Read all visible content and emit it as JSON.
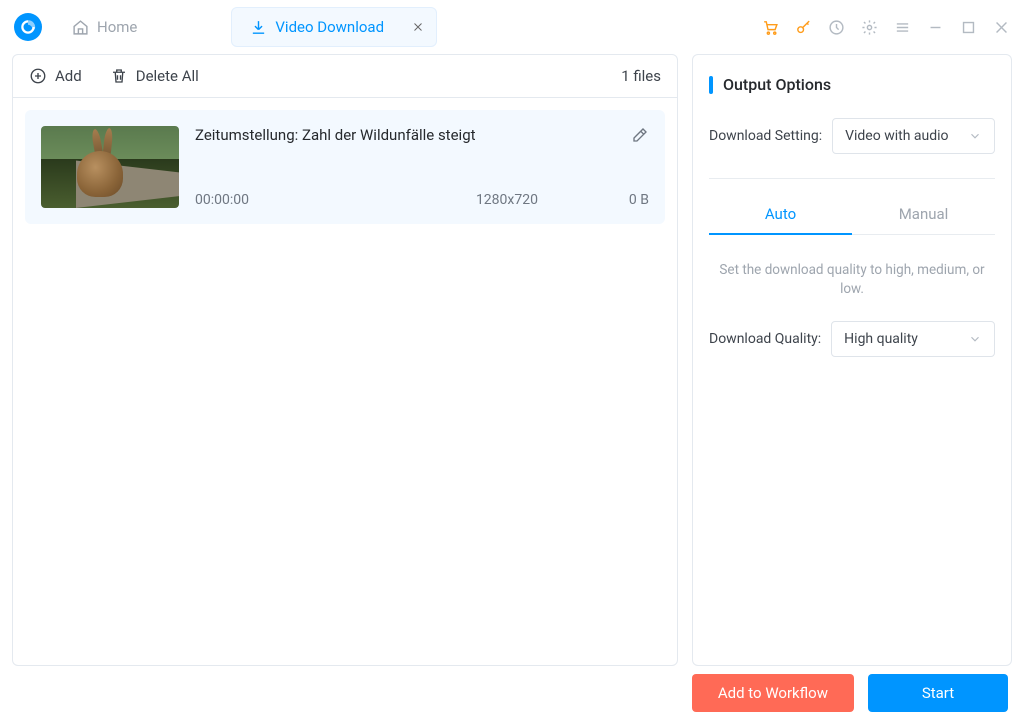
{
  "tabs": {
    "home": "Home",
    "active": "Video Download"
  },
  "toolbar": {
    "add": "Add",
    "delete_all": "Delete All",
    "count": "1 files"
  },
  "item": {
    "title": "Zeitumstellung: Zahl der Wildunfälle steigt",
    "duration": "00:00:00",
    "resolution": "1280x720",
    "size": "0 B"
  },
  "panel": {
    "title": "Output Options",
    "dl_setting_label": "Download Setting:",
    "dl_setting_value": "Video with audio",
    "tab_auto": "Auto",
    "tab_manual": "Manual",
    "hint": "Set the download quality to high, medium, or low.",
    "dl_quality_label": "Download Quality:",
    "dl_quality_value": "High quality"
  },
  "footer": {
    "workflow": "Add to Workflow",
    "start": "Start"
  }
}
